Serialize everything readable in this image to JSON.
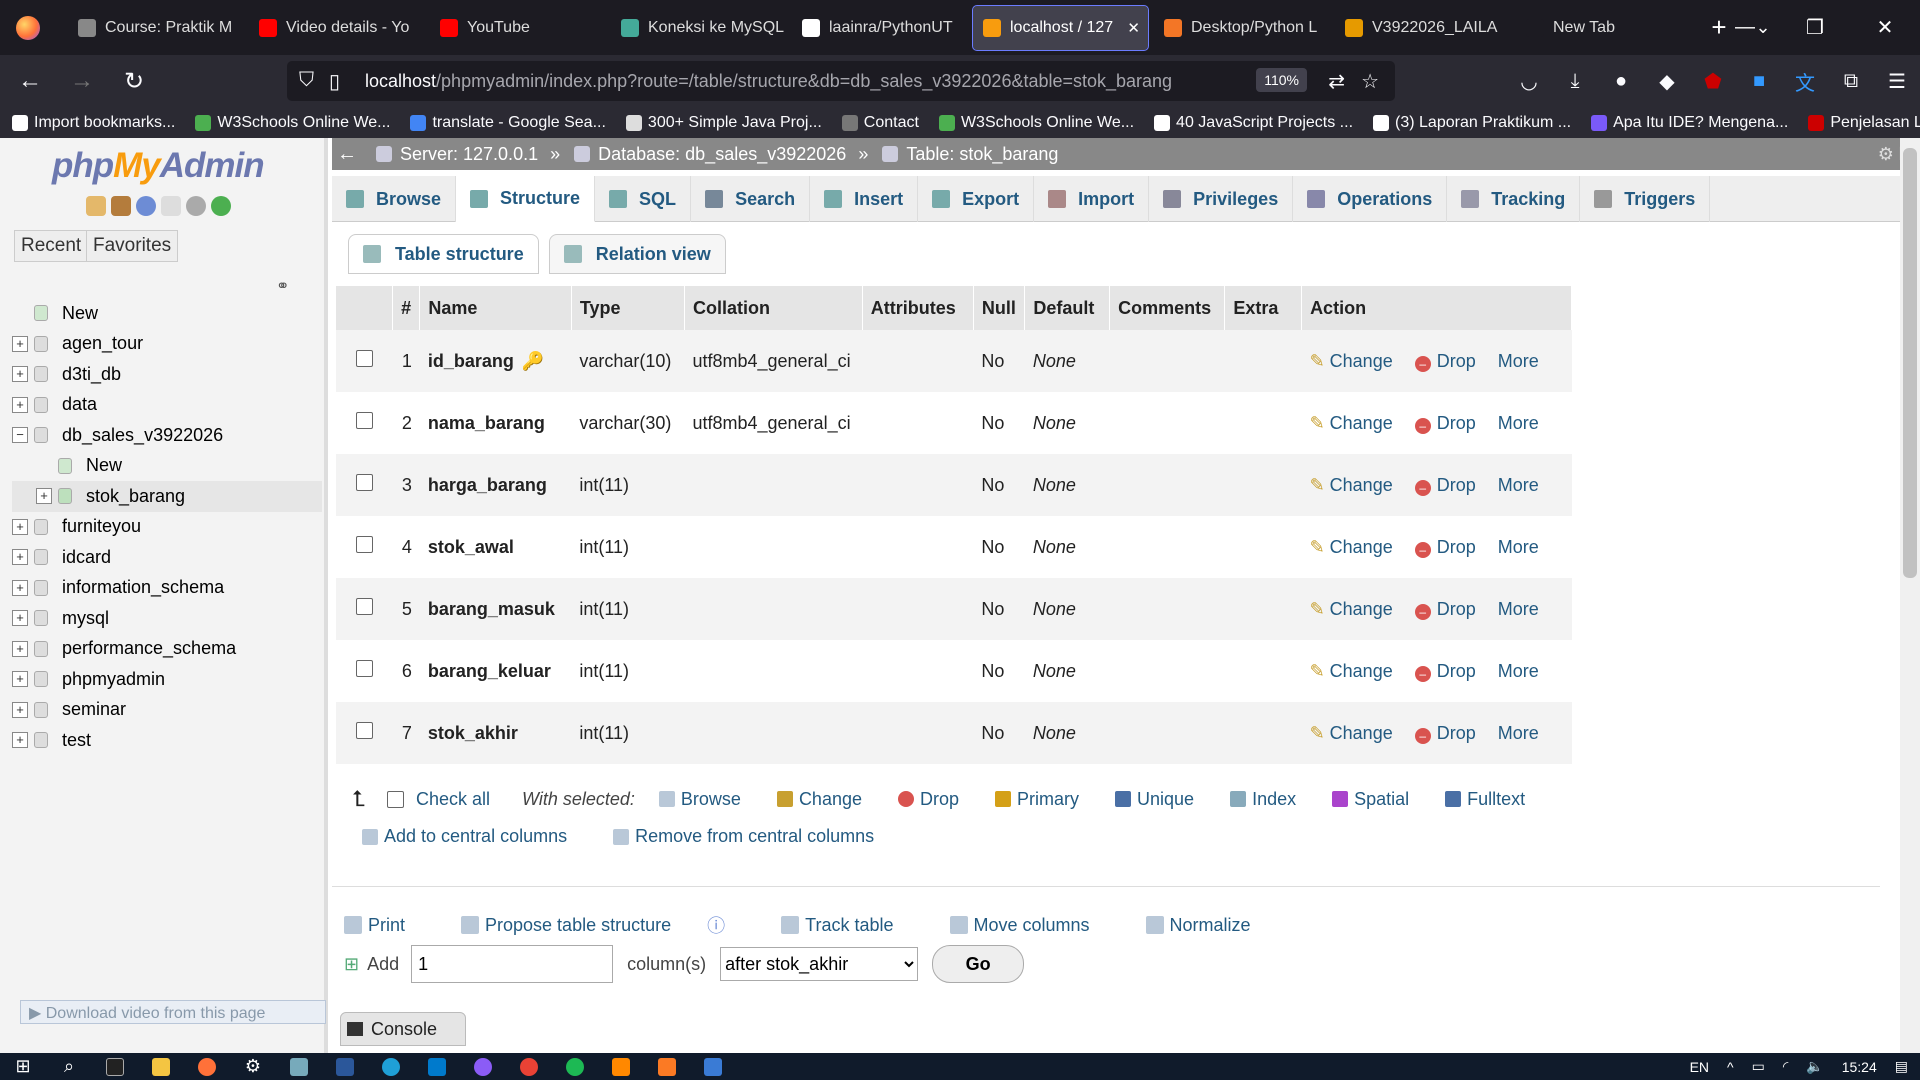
{
  "browser": {
    "tabs": [
      {
        "label": "Course: Praktik M",
        "color": "#888"
      },
      {
        "label": "Video details - Yo",
        "color": "#f00"
      },
      {
        "label": "YouTube",
        "color": "#f00"
      },
      {
        "label": "Koneksi ke MySQL",
        "color": "#4a9"
      },
      {
        "label": "laainra/PythonUT",
        "color": "#fff"
      },
      {
        "label": "localhost / 127",
        "color": "#f89c0e",
        "active": true
      },
      {
        "label": "Desktop/Python L",
        "color": "#f37626"
      },
      {
        "label": "V3922026_LAILA",
        "color": "#e69a00"
      },
      {
        "label": "New Tab",
        "color": "#1c1b22"
      }
    ],
    "url_host": "localhost",
    "url_path": "/phpmyadmin/index.php?route=/table/structure&db=db_sales_v3922026&table=stok_barang",
    "zoom": "110%",
    "bookmarks": [
      "Import bookmarks...",
      "W3Schools Online We...",
      "translate - Google Sea...",
      "300+ Simple Java Proj...",
      "Contact",
      "W3Schools Online We...",
      "40 JavaScript Projects ...",
      "(3) Laporan Praktikum ...",
      "Apa Itu IDE? Mengena...",
      "Penjelasan Lengkap K..."
    ]
  },
  "sidebar": {
    "logo_php": "php",
    "logo_my": "My",
    "logo_admin": "Admin",
    "recent": "Recent",
    "favorites": "Favorites",
    "tree": [
      {
        "label": "New",
        "pm": "",
        "indent": 0
      },
      {
        "label": "agen_tour",
        "pm": "+",
        "indent": 0
      },
      {
        "label": "d3ti_db",
        "pm": "+",
        "indent": 0
      },
      {
        "label": "data",
        "pm": "+",
        "indent": 0
      },
      {
        "label": "db_sales_v3922026",
        "pm": "−",
        "indent": 0
      },
      {
        "label": "New",
        "pm": "",
        "indent": 1
      },
      {
        "label": "stok_barang",
        "pm": "+",
        "indent": 1,
        "selected": true
      },
      {
        "label": "furniteyou",
        "pm": "+",
        "indent": 0
      },
      {
        "label": "idcard",
        "pm": "+",
        "indent": 0
      },
      {
        "label": "information_schema",
        "pm": "+",
        "indent": 0
      },
      {
        "label": "mysql",
        "pm": "+",
        "indent": 0
      },
      {
        "label": "performance_schema",
        "pm": "+",
        "indent": 0
      },
      {
        "label": "phpmyadmin",
        "pm": "+",
        "indent": 0
      },
      {
        "label": "seminar",
        "pm": "+",
        "indent": 0
      },
      {
        "label": "test",
        "pm": "+",
        "indent": 0
      }
    ],
    "download_video": "▶ Download video from this page"
  },
  "breadcrumb": {
    "server": "Server: 127.0.0.1",
    "database": "Database: db_sales_v3922026",
    "table": "Table: stok_barang",
    "sep": "»"
  },
  "menu": [
    "Browse",
    "Structure",
    "SQL",
    "Search",
    "Insert",
    "Export",
    "Import",
    "Privileges",
    "Operations",
    "Tracking",
    "Triggers"
  ],
  "subtabs": [
    "Table structure",
    "Relation view"
  ],
  "columns": [
    "#",
    "Name",
    "Type",
    "Collation",
    "Attributes",
    "Null",
    "Default",
    "Comments",
    "Extra",
    "Action"
  ],
  "rows": [
    {
      "num": "1",
      "name": "id_barang",
      "type": "varchar(10)",
      "collation": "utf8mb4_general_ci",
      "null": "No",
      "default": "None",
      "key": true
    },
    {
      "num": "2",
      "name": "nama_barang",
      "type": "varchar(30)",
      "collation": "utf8mb4_general_ci",
      "null": "No",
      "default": "None",
      "key": false
    },
    {
      "num": "3",
      "name": "harga_barang",
      "type": "int(11)",
      "collation": "",
      "null": "No",
      "default": "None",
      "key": false
    },
    {
      "num": "4",
      "name": "stok_awal",
      "type": "int(11)",
      "collation": "",
      "null": "No",
      "default": "None",
      "key": false
    },
    {
      "num": "5",
      "name": "barang_masuk",
      "type": "int(11)",
      "collation": "",
      "null": "No",
      "default": "None",
      "key": false
    },
    {
      "num": "6",
      "name": "barang_keluar",
      "type": "int(11)",
      "collation": "",
      "null": "No",
      "default": "None",
      "key": false
    },
    {
      "num": "7",
      "name": "stok_akhir",
      "type": "int(11)",
      "collation": "",
      "null": "No",
      "default": "None",
      "key": false
    }
  ],
  "actions": {
    "change": "Change",
    "drop": "Drop",
    "more": "More"
  },
  "with_selected": {
    "check_all": "Check all",
    "label": "With selected:",
    "items": [
      "Browse",
      "Change",
      "Drop",
      "Primary",
      "Unique",
      "Index",
      "Spatial",
      "Fulltext"
    ],
    "add_central": "Add to central columns",
    "remove_central": "Remove from central columns"
  },
  "tools": [
    "Print",
    "Propose table structure",
    "Track table",
    "Move columns",
    "Normalize"
  ],
  "add_columns": {
    "add": "Add",
    "value": "1",
    "columns_label": "column(s)",
    "position": "after stok_akhir",
    "go": "Go"
  },
  "console": "Console",
  "taskbar": {
    "lang": "EN",
    "time": "15:24"
  }
}
